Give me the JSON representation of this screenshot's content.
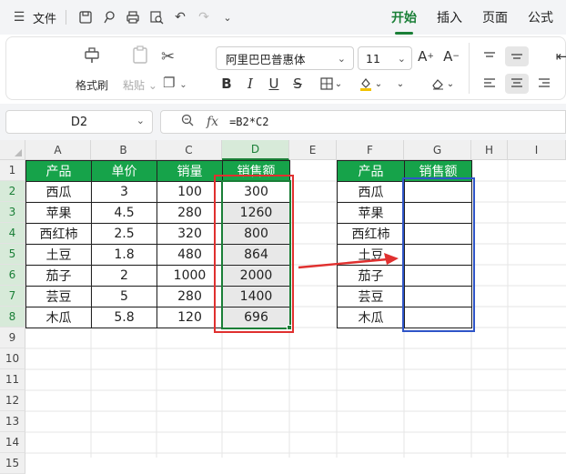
{
  "menu": {
    "file_label": "文件",
    "tabs": [
      "开始",
      "插入",
      "页面",
      "公式"
    ],
    "active_tab": "开始"
  },
  "ribbon": {
    "format_painter": "格式刷",
    "paste": "粘贴",
    "font_name": "阿里巴巴普惠体",
    "font_size": "11"
  },
  "formula_bar": {
    "cell_ref": "D2",
    "fx_label": "fx",
    "formula": "=B2*C2"
  },
  "sheet": {
    "columns": [
      "A",
      "B",
      "C",
      "D",
      "E",
      "F",
      "G",
      "H",
      "I"
    ],
    "selected_column": "D",
    "rows": [
      "1",
      "2",
      "3",
      "4",
      "5",
      "6",
      "7",
      "8",
      "9",
      "10",
      "11",
      "12",
      "13",
      "14",
      "15"
    ],
    "left_table": {
      "headers": [
        "产品",
        "单价",
        "销量",
        "销售额"
      ],
      "rows": [
        [
          "西瓜",
          "3",
          "100",
          "300"
        ],
        [
          "苹果",
          "4.5",
          "280",
          "1260"
        ],
        [
          "西红柿",
          "2.5",
          "320",
          "800"
        ],
        [
          "土豆",
          "1.8",
          "480",
          "864"
        ],
        [
          "茄子",
          "2",
          "1000",
          "2000"
        ],
        [
          "芸豆",
          "5",
          "280",
          "1400"
        ],
        [
          "木瓜",
          "5.8",
          "120",
          "696"
        ]
      ]
    },
    "right_table": {
      "headers": [
        "产品",
        "销售额"
      ],
      "products": [
        "西瓜",
        "苹果",
        "西红柿",
        "土豆",
        "茄子",
        "芸豆",
        "木瓜"
      ]
    }
  },
  "colors": {
    "header_green": "#16a34a",
    "accent_green": "#1a7f37",
    "annotation_red": "#e0302f",
    "annotation_blue": "#2f55c8"
  }
}
